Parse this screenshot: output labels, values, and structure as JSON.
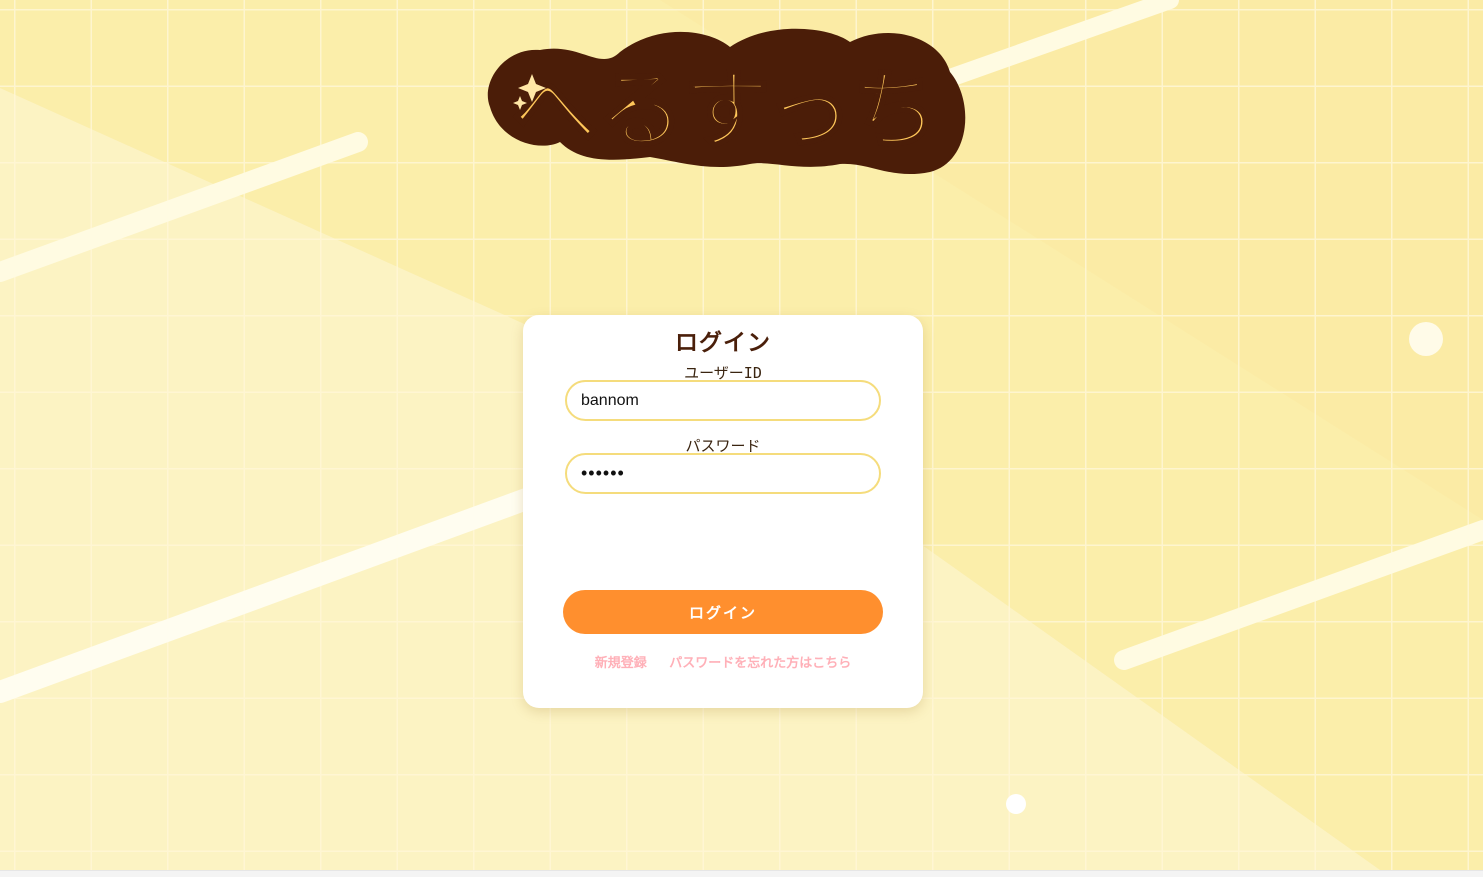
{
  "app": {
    "logo_text": "へるすっち"
  },
  "login_card": {
    "title": "ログイン",
    "user_id_label": "ユーザーID",
    "user_id_value": "bannom",
    "password_label": "パスワード",
    "password_value": "••••••",
    "login_button_label": "ログイン",
    "links": {
      "register": "新規登録",
      "forgot_password": "パスワードを忘れた方はこちら"
    }
  },
  "colors": {
    "background": "#fbeeaa",
    "accent_button": "#ff8f2e",
    "input_border": "#f5dc7c",
    "link": "#ffb0b8",
    "title": "#4a1f0a"
  },
  "icons": {
    "logo_sparkle": "sparkle-icon"
  }
}
